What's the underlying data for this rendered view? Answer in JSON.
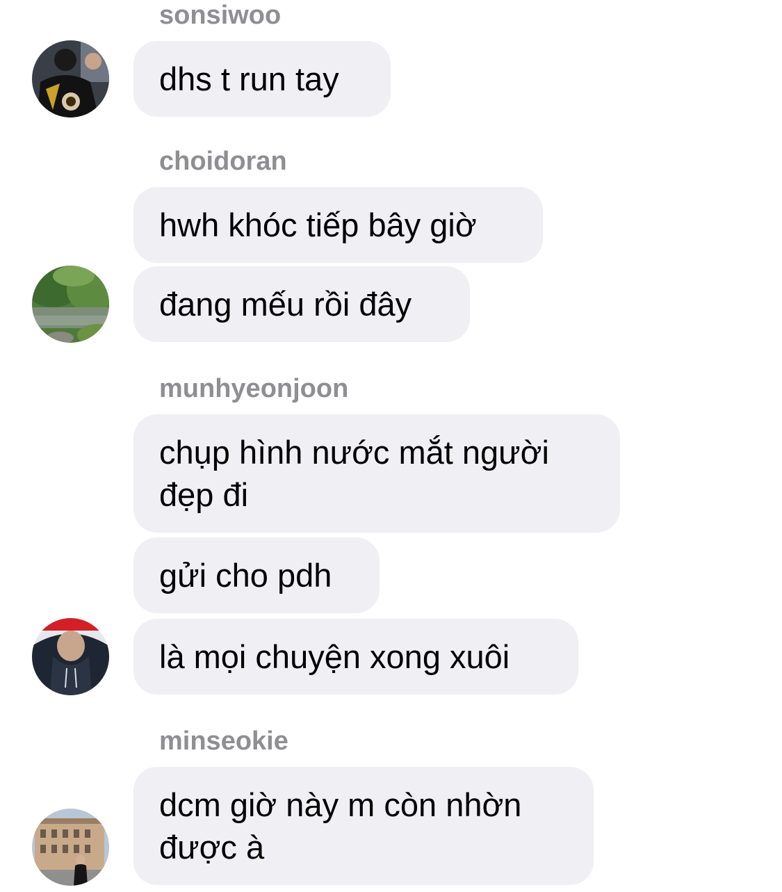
{
  "groups": [
    {
      "sender": "sonsiwoo",
      "avatar_icon": "profile-photo-jersey-icon",
      "messages": [
        "dhs t run tay"
      ]
    },
    {
      "sender": "choidoran",
      "avatar_icon": "profile-photo-landscape-icon",
      "messages": [
        "hwh khóc tiếp bây giờ",
        "đang mếu rồi đây"
      ]
    },
    {
      "sender": "munhyeonjoon",
      "avatar_icon": "profile-photo-hoodie-icon",
      "messages": [
        "chụp hình nước mắt người\nđẹp đi",
        "gửi cho pdh",
        "là mọi chuyện xong xuôi"
      ]
    },
    {
      "sender": "minseokie",
      "avatar_icon": "profile-photo-building-icon",
      "messages": [
        "dcm giờ này m còn nhờn\nđược à"
      ]
    }
  ],
  "colors": {
    "bubble_bg": "#efeff4",
    "sender_text": "#8e8e93",
    "message_text": "#000000"
  }
}
